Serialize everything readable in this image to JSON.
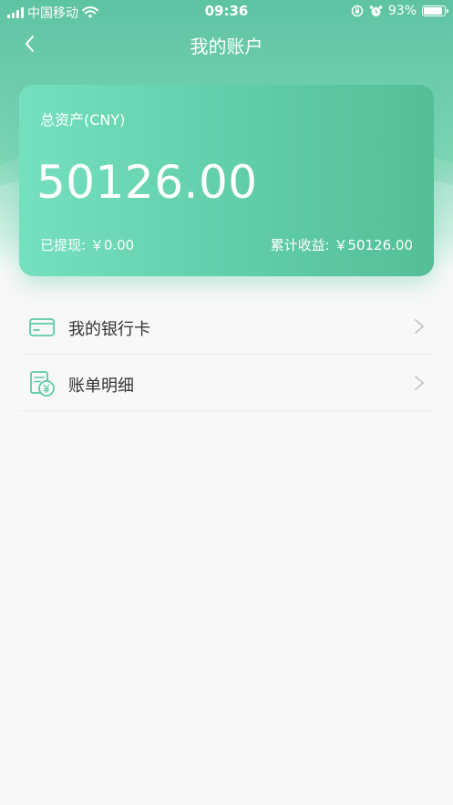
{
  "status_bar": {
    "carrier": "中国移动",
    "time": "09:36",
    "battery": "93%",
    "battery_level": 0.93
  },
  "nav": {
    "title": "我的账户"
  },
  "account_card": {
    "label": "总资产(CNY)",
    "amount": "50126.00",
    "withdrawn": "已提现: ￥0.00",
    "earnings": "累计收益: ￥50126.00"
  },
  "menu": {
    "items": [
      {
        "label": "我的银行卡",
        "icon": "bank-card-icon"
      },
      {
        "label": "账单明细",
        "icon": "bill-detail-icon"
      }
    ]
  },
  "colors": {
    "accent": "#5ec3a3",
    "icon": "#5ccaa6",
    "chevron": "#c4c4c4",
    "text": "#333333"
  }
}
